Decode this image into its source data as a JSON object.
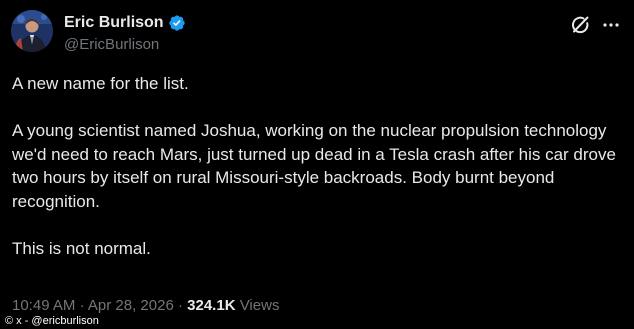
{
  "post": {
    "author_name": "Eric Burlison",
    "handle": "@EricBurlison",
    "verified": true,
    "paragraphs": [
      "A new name for the list.",
      "A young scientist named Joshua, working on the nuclear propulsion technology we'd need to reach Mars, just turned up dead in a Tesla crash after his car drove two hours by itself on rural Missouri-style backroads. Body burnt beyond recognition.",
      "This is not normal."
    ],
    "time": "10:49 AM",
    "separator": "·",
    "date": "Apr 28, 2026",
    "views_count": "324.1K",
    "views_label": "Views"
  },
  "icons": {
    "verified": "verified-badge-icon",
    "grok": "grok-icon",
    "more": "more-icon"
  },
  "watermark": "© x - @ericburlison",
  "colors": {
    "background": "#000000",
    "text_primary": "#e7e9ea",
    "text_secondary": "#71767b",
    "verified": "#1d9bf0"
  }
}
